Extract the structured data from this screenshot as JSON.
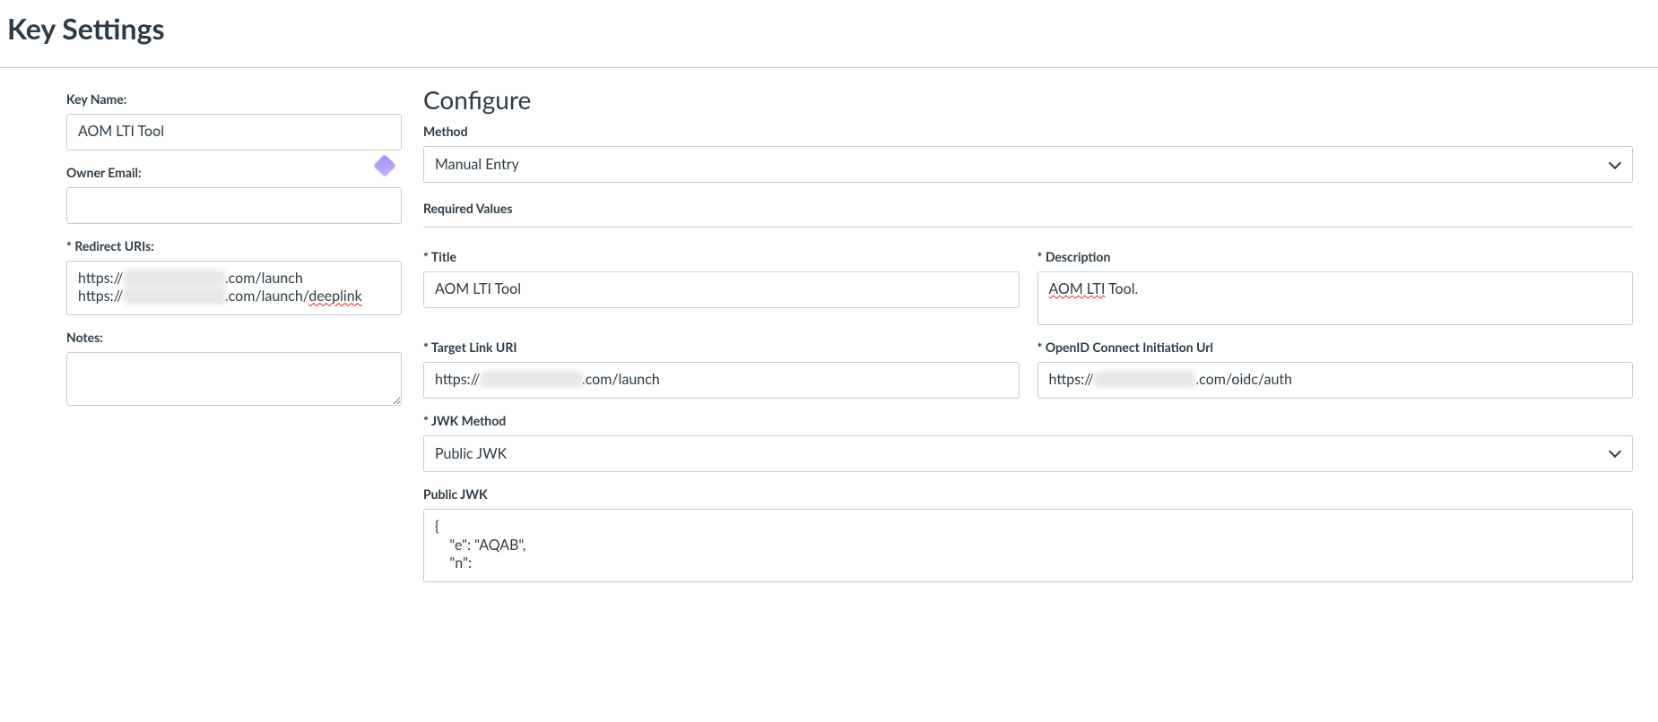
{
  "header": {
    "title": "Key Settings"
  },
  "left": {
    "key_name": {
      "label": "Key Name:",
      "value": "AOM LTI Tool"
    },
    "owner_email": {
      "label": "Owner Email:",
      "value": ""
    },
    "redirect_uris": {
      "label": "* Redirect URIs:",
      "line1_prefix": "https://",
      "line1_redacted": "██████████",
      "line1_suffix": ".com/launch",
      "line2_prefix": "https://",
      "line2_redacted": "██████████",
      "line2_suffix": ".com/launch/",
      "line2_deeplink": "deeplink"
    },
    "notes": {
      "label": "Notes:",
      "value": ""
    }
  },
  "right": {
    "configure_title": "Configure",
    "method": {
      "label": "Method",
      "selected": "Manual Entry"
    },
    "required_values_heading": "Required Values",
    "title": {
      "label": "* Title",
      "value": "AOM LTI Tool"
    },
    "description": {
      "label": "* Description",
      "value_prefix": "AOM LTI",
      "value_suffix": " Tool."
    },
    "target_link_uri": {
      "label": "* Target Link URI",
      "prefix": "https://",
      "redacted": "██████████",
      "suffix": ".com/launch"
    },
    "openid_url": {
      "label": "* OpenID Connect Initiation Url",
      "prefix": "https://",
      "redacted": "██████████",
      "suffix": ".com/oidc/auth"
    },
    "jwk_method": {
      "label": "* JWK Method",
      "selected": "Public JWK"
    },
    "public_jwk": {
      "label": "Public JWK",
      "line1": "{",
      "line2": "    \"e\": \"AQAB\",",
      "line3": "    \"n\":"
    }
  }
}
